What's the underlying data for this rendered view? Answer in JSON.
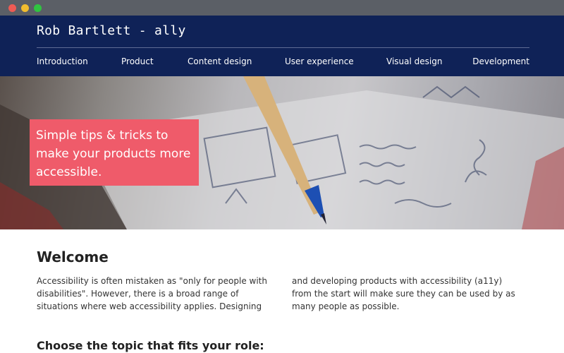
{
  "window": {
    "controls": [
      "close",
      "minimize",
      "maximize"
    ]
  },
  "header": {
    "site_title": "Rob Bartlett - ally",
    "nav": [
      {
        "label": "Introduction"
      },
      {
        "label": "Product"
      },
      {
        "label": "Content design"
      },
      {
        "label": "User experience"
      },
      {
        "label": "Visual design"
      },
      {
        "label": "Development"
      }
    ]
  },
  "hero": {
    "callout": "Simple tips & tricks to make your products more accessible.",
    "callout_color": "#ef5b6a"
  },
  "main": {
    "title": "Welcome",
    "intro_col1": "Accessibility is often mistaken as \"only for people with disabilities\". However, there is a broad range of situations where web accessibility applies. Designing",
    "intro_col2": "and developing products with accessibility (a11y) from the start will make sure they can be used by as many people as possible.",
    "section_heading": "Choose the topic that fits your role:"
  },
  "colors": {
    "header_bg": "#0f2257",
    "accent": "#ef5b6a"
  }
}
